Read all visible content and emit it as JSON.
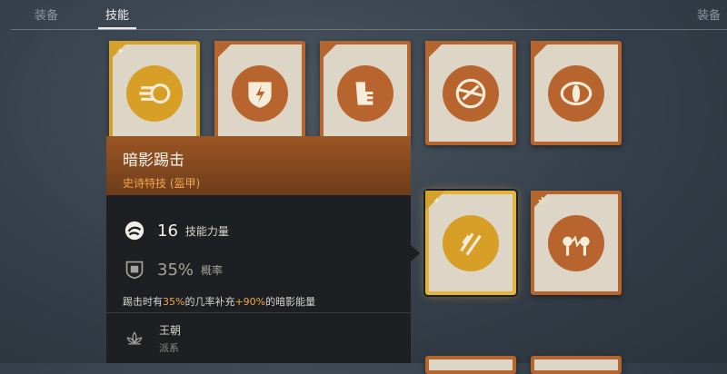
{
  "tabs": [
    {
      "label": "装备",
      "active": false
    },
    {
      "label": "技能",
      "active": true
    },
    {
      "label": "装备",
      "active": false
    }
  ],
  "cards": [
    {
      "name": "card-1",
      "icon": "dash-strike-icon",
      "rarity": "epic"
    },
    {
      "name": "card-2",
      "icon": "shield-bolt-icon",
      "rarity": "normal"
    },
    {
      "name": "card-3",
      "icon": "fist-icon",
      "rarity": "normal"
    },
    {
      "name": "card-4",
      "icon": "broken-shield-icon",
      "rarity": "normal"
    },
    {
      "name": "card-5",
      "icon": "eye-icon",
      "rarity": "normal"
    },
    {
      "name": "card-6",
      "icon": "lightning-slash-icon",
      "rarity": "epic",
      "selected": true
    },
    {
      "name": "card-7",
      "icon": "electric-link-icon",
      "rarity": "normal"
    }
  ],
  "tooltip": {
    "title": "暗影踢击",
    "subtitle": "史诗特技 (盔甲)",
    "stats": [
      {
        "value": "16",
        "label": "技能力量",
        "icon": "swirl-icon"
      },
      {
        "value": "35%",
        "label": "概率",
        "icon": "dice-shield-icon"
      }
    ],
    "description": {
      "p1": "踢击时有",
      "h1": "35%",
      "p2": "的几率补充",
      "h2": "+90%",
      "p3": "的暗影能量"
    },
    "faction": {
      "name": "王朝",
      "type": "派系",
      "icon": "lotus-icon"
    }
  },
  "colors": {
    "accent": "#f0a646",
    "card_border": "#b5652e",
    "epic_border": "#d4a12a"
  }
}
